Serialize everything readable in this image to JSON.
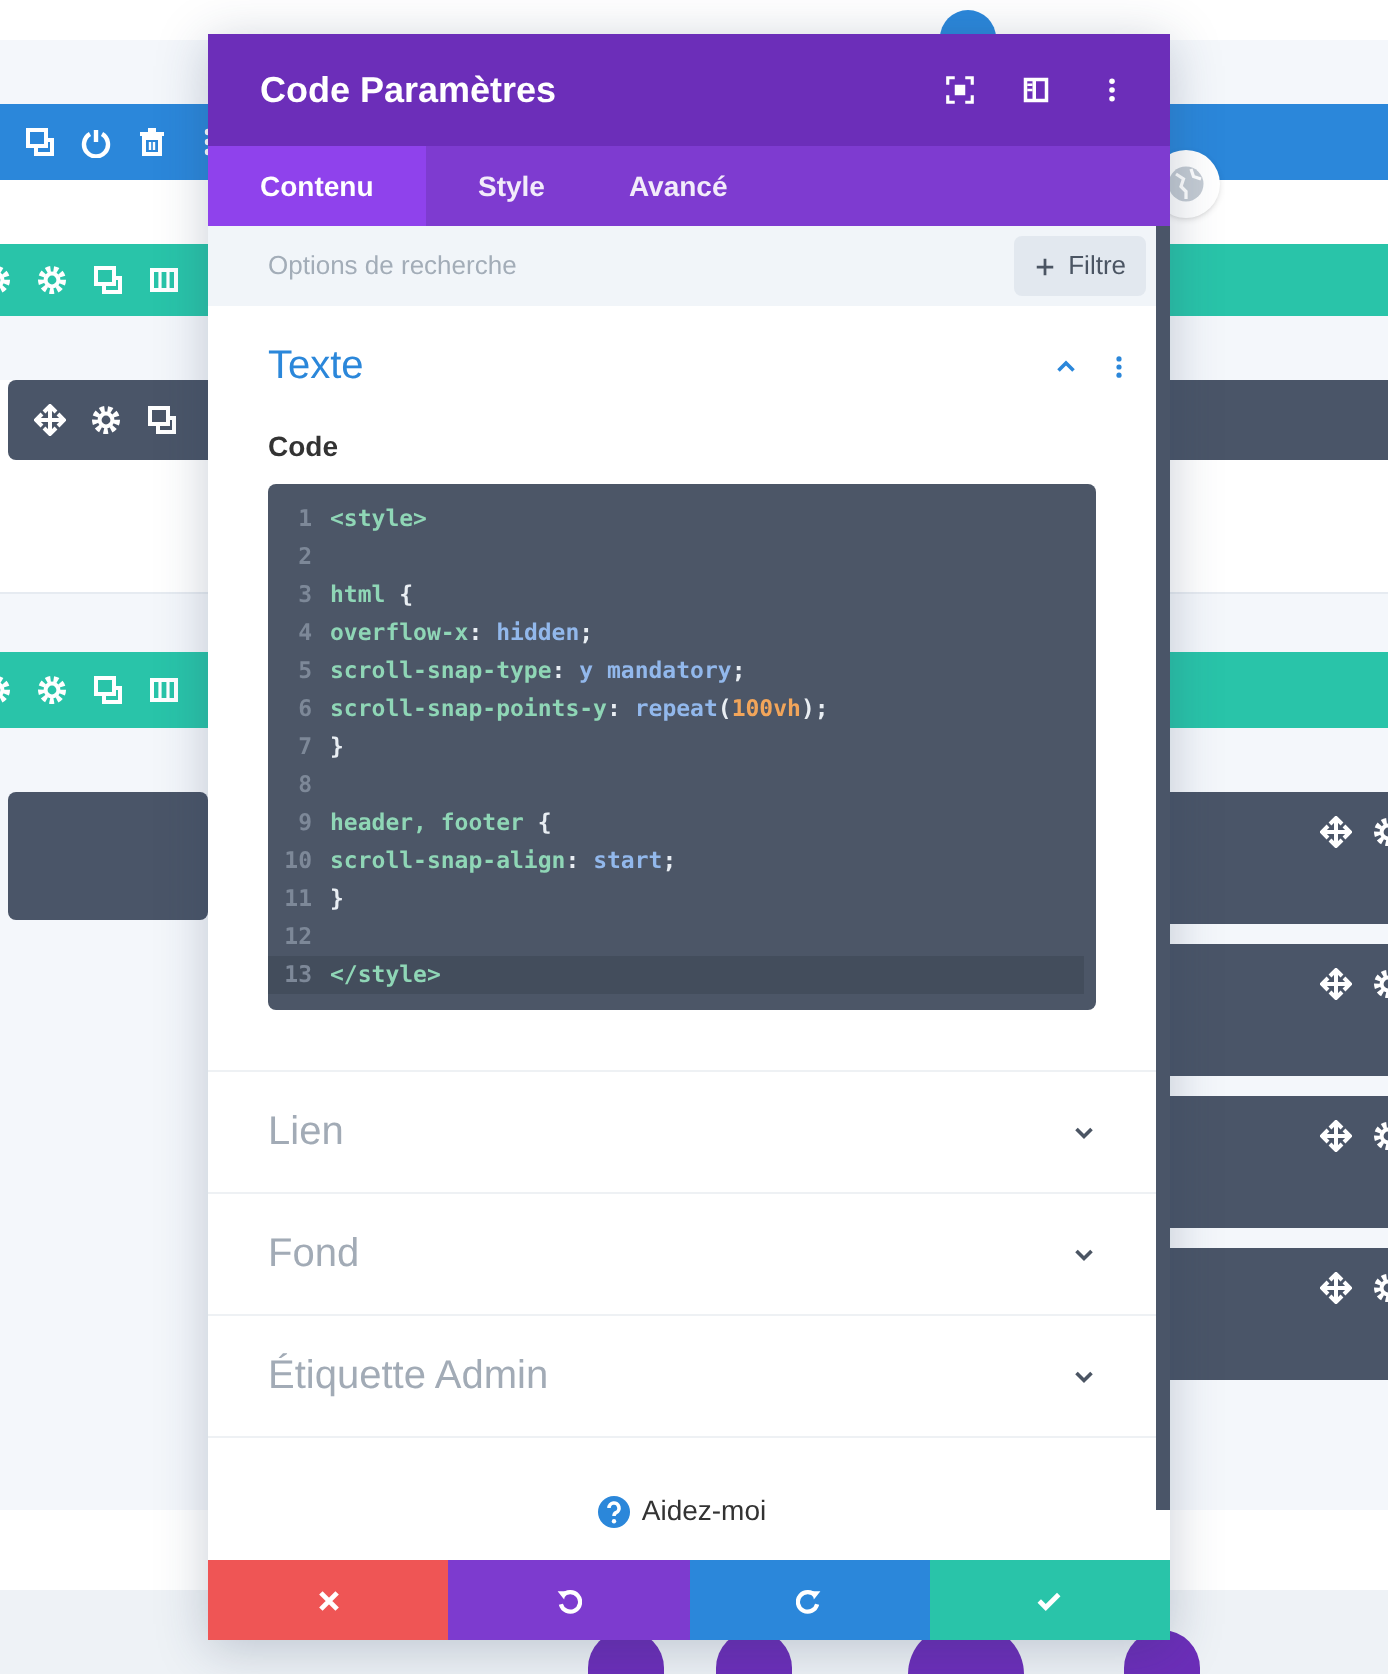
{
  "modal": {
    "title": "Code Paramètres",
    "tabs": [
      {
        "label": "Contenu",
        "selected": true
      },
      {
        "label": "Style",
        "selected": false
      },
      {
        "label": "Avancé",
        "selected": false
      }
    ],
    "search": {
      "placeholder": "Options de recherche"
    },
    "filter_button": "Filtre",
    "sections": [
      {
        "title": "Texte",
        "expanded": true,
        "field_label": "Code",
        "code_lines": [
          {
            "number": "1",
            "active": false,
            "tokens": [
              {
                "text": "<style>",
                "kind": "selector"
              }
            ]
          },
          {
            "number": "2",
            "active": false
          },
          {
            "number": "3",
            "active": false,
            "tokens": [
              {
                "text": "html",
                "kind": "selector"
              },
              {
                "text": " {",
                "kind": "punct"
              }
            ]
          },
          {
            "number": "4",
            "active": false,
            "tokens": [
              {
                "text": "overflow-x",
                "kind": "property"
              },
              {
                "text": ": ",
                "kind": "punct"
              },
              {
                "text": "hidden",
                "kind": "value"
              },
              {
                "text": ";",
                "kind": "punct"
              }
            ]
          },
          {
            "number": "5",
            "active": false,
            "tokens": [
              {
                "text": "scroll-snap-type",
                "kind": "property"
              },
              {
                "text": ": ",
                "kind": "punct"
              },
              {
                "text": "y mandatory",
                "kind": "value"
              },
              {
                "text": ";",
                "kind": "punct"
              }
            ]
          },
          {
            "number": "6",
            "active": false,
            "tokens": [
              {
                "text": "scroll-snap-points-y",
                "kind": "property"
              },
              {
                "text": ": ",
                "kind": "punct"
              },
              {
                "text": "repeat",
                "kind": "value"
              },
              {
                "text": "(",
                "kind": "punct"
              },
              {
                "text": "100vh",
                "kind": "number"
              },
              {
                "text": ");",
                "kind": "punct"
              }
            ]
          },
          {
            "number": "7",
            "active": false,
            "tokens": [
              {
                "text": "}",
                "kind": "punct"
              }
            ]
          },
          {
            "number": "8",
            "active": false
          },
          {
            "number": "9",
            "active": false,
            "tokens": [
              {
                "text": "header, footer",
                "kind": "selector"
              },
              {
                "text": " {",
                "kind": "punct"
              }
            ]
          },
          {
            "number": "10",
            "active": false,
            "tokens": [
              {
                "text": "scroll-snap-align",
                "kind": "property"
              },
              {
                "text": ": ",
                "kind": "punct"
              },
              {
                "text": "start",
                "kind": "value"
              },
              {
                "text": ";",
                "kind": "punct"
              }
            ]
          },
          {
            "number": "11",
            "active": false,
            "tokens": [
              {
                "text": "}",
                "kind": "punct"
              }
            ]
          },
          {
            "number": "12",
            "active": false
          },
          {
            "number": "13",
            "active": true,
            "tokens": [
              {
                "text": "</style>",
                "kind": "selector"
              }
            ]
          }
        ]
      },
      {
        "title": "Lien",
        "expanded": false
      },
      {
        "title": "Fond",
        "expanded": false
      },
      {
        "title": "Étiquette Admin",
        "expanded": false
      }
    ],
    "help_link": "Aidez-moi",
    "footer_buttons": [
      {
        "kind": "cancel"
      },
      {
        "kind": "undo"
      },
      {
        "kind": "redo"
      },
      {
        "kind": "save"
      }
    ]
  }
}
